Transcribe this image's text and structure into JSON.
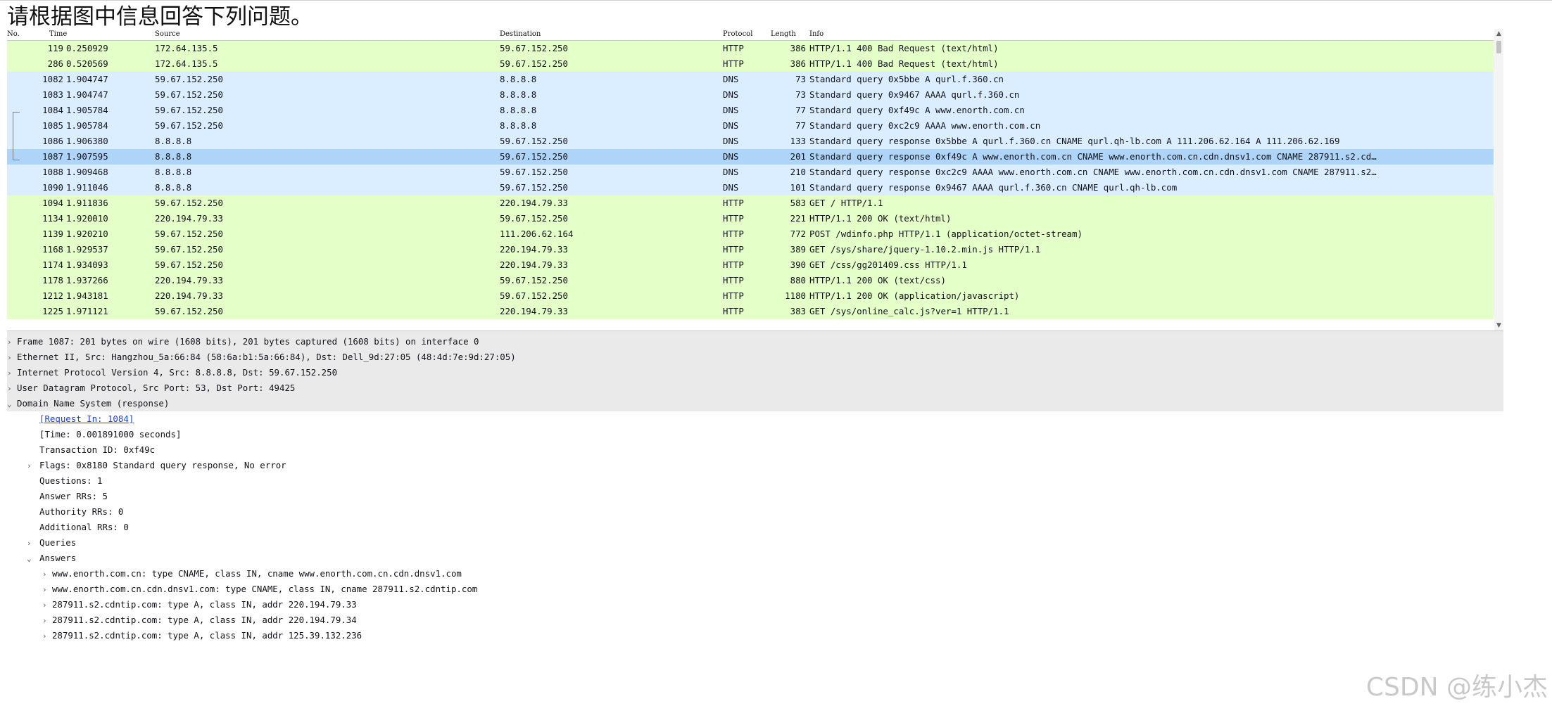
{
  "question": "请根据图中信息回答下列问题。",
  "columns": {
    "no": "No.",
    "time": "Time",
    "source": "Source",
    "destination": "Destination",
    "protocol": "Protocol",
    "length": "Length",
    "info": "Info"
  },
  "packets": [
    {
      "no": "119",
      "time": "0.250929",
      "src": "172.64.135.5",
      "dst": "59.67.152.250",
      "proto": "HTTP",
      "len": "386",
      "info": "HTTP/1.1 400 Bad Request  (text/html)"
    },
    {
      "no": "286",
      "time": "0.520569",
      "src": "172.64.135.5",
      "dst": "59.67.152.250",
      "proto": "HTTP",
      "len": "386",
      "info": "HTTP/1.1 400 Bad Request  (text/html)"
    },
    {
      "no": "1082",
      "time": "1.904747",
      "src": "59.67.152.250",
      "dst": "8.8.8.8",
      "proto": "DNS",
      "len": "73",
      "info": "Standard query 0x5bbe A qurl.f.360.cn"
    },
    {
      "no": "1083",
      "time": "1.904747",
      "src": "59.67.152.250",
      "dst": "8.8.8.8",
      "proto": "DNS",
      "len": "73",
      "info": "Standard query 0x9467 AAAA qurl.f.360.cn"
    },
    {
      "no": "1084",
      "time": "1.905784",
      "src": "59.67.152.250",
      "dst": "8.8.8.8",
      "proto": "DNS",
      "len": "77",
      "info": "Standard query 0xf49c A www.enorth.com.cn"
    },
    {
      "no": "1085",
      "time": "1.905784",
      "src": "59.67.152.250",
      "dst": "8.8.8.8",
      "proto": "DNS",
      "len": "77",
      "info": "Standard query 0xc2c9 AAAA www.enorth.com.cn"
    },
    {
      "no": "1086",
      "time": "1.906380",
      "src": "8.8.8.8",
      "dst": "59.67.152.250",
      "proto": "DNS",
      "len": "133",
      "info": "Standard query response 0x5bbe A qurl.f.360.cn CNAME qurl.qh-lb.com A 111.206.62.164 A 111.206.62.169"
    },
    {
      "no": "1087",
      "time": "1.907595",
      "src": "8.8.8.8",
      "dst": "59.67.152.250",
      "proto": "DNS",
      "len": "201",
      "info": "Standard query response 0xf49c A www.enorth.com.cn CNAME www.enorth.com.cn.cdn.dnsv1.com CNAME 287911.s2.cd…"
    },
    {
      "no": "1088",
      "time": "1.909468",
      "src": "8.8.8.8",
      "dst": "59.67.152.250",
      "proto": "DNS",
      "len": "210",
      "info": "Standard query response 0xc2c9 AAAA www.enorth.com.cn CNAME www.enorth.com.cn.cdn.dnsv1.com CNAME 287911.s2…"
    },
    {
      "no": "1090",
      "time": "1.911046",
      "src": "8.8.8.8",
      "dst": "59.67.152.250",
      "proto": "DNS",
      "len": "101",
      "info": "Standard query response 0x9467 AAAA qurl.f.360.cn CNAME qurl.qh-lb.com"
    },
    {
      "no": "1094",
      "time": "1.911836",
      "src": "59.67.152.250",
      "dst": "220.194.79.33",
      "proto": "HTTP",
      "len": "583",
      "info": "GET / HTTP/1.1"
    },
    {
      "no": "1134",
      "time": "1.920010",
      "src": "220.194.79.33",
      "dst": "59.67.152.250",
      "proto": "HTTP",
      "len": "221",
      "info": "HTTP/1.1 200 OK  (text/html)"
    },
    {
      "no": "1139",
      "time": "1.920210",
      "src": "59.67.152.250",
      "dst": "111.206.62.164",
      "proto": "HTTP",
      "len": "772",
      "info": "POST /wdinfo.php HTTP/1.1  (application/octet-stream)"
    },
    {
      "no": "1168",
      "time": "1.929537",
      "src": "59.67.152.250",
      "dst": "220.194.79.33",
      "proto": "HTTP",
      "len": "389",
      "info": "GET /sys/share/jquery-1.10.2.min.js HTTP/1.1"
    },
    {
      "no": "1174",
      "time": "1.934093",
      "src": "59.67.152.250",
      "dst": "220.194.79.33",
      "proto": "HTTP",
      "len": "390",
      "info": "GET /css/gg201409.css HTTP/1.1"
    },
    {
      "no": "1178",
      "time": "1.937266",
      "src": "220.194.79.33",
      "dst": "59.67.152.250",
      "proto": "HTTP",
      "len": "880",
      "info": "HTTP/1.1 200 OK  (text/css)"
    },
    {
      "no": "1212",
      "time": "1.943181",
      "src": "220.194.79.33",
      "dst": "59.67.152.250",
      "proto": "HTTP",
      "len": "1180",
      "info": "HTTP/1.1 200 OK  (application/javascript)"
    },
    {
      "no": "1225",
      "time": "1.971121",
      "src": "59.67.152.250",
      "dst": "220.194.79.33",
      "proto": "HTTP",
      "len": "383",
      "info": "GET /sys/online_calc.js?ver=1 HTTP/1.1"
    }
  ],
  "selected_packet_no": "1087",
  "details": {
    "frame": "Frame 1087: 201 bytes on wire (1608 bits), 201 bytes captured (1608 bits) on interface 0",
    "ethernet": "Ethernet II, Src: Hangzhou_5a:66:84 (58:6a:b1:5a:66:84), Dst: Dell_9d:27:05 (48:4d:7e:9d:27:05)",
    "ip": "Internet Protocol Version 4, Src: 8.8.8.8, Dst: 59.67.152.250",
    "udp": "User Datagram Protocol, Src Port: 53, Dst Port: 49425",
    "dns": "Domain Name System (response)",
    "request_in": "[Request In: 1084]",
    "time": "[Time: 0.001891000 seconds]",
    "transaction_id": "Transaction ID: 0xf49c",
    "flags": "Flags: 0x8180 Standard query response, No error",
    "questions": "Questions: 1",
    "answer_rrs": "Answer RRs: 5",
    "authority_rrs": "Authority RRs: 0",
    "additional_rrs": "Additional RRs: 0",
    "queries": "Queries",
    "answers": "Answers",
    "answer_items": [
      "www.enorth.com.cn: type CNAME, class IN, cname www.enorth.com.cn.cdn.dnsv1.com",
      "www.enorth.com.cn.cdn.dnsv1.com: type CNAME, class IN, cname 287911.s2.cdntip.com",
      "287911.s2.cdntip.com: type A, class IN, addr 220.194.79.33",
      "287911.s2.cdntip.com: type A, class IN, addr 220.194.79.34",
      "287911.s2.cdntip.com: type A, class IN, addr 125.39.132.236"
    ]
  },
  "watermark": "CSDN @练小杰"
}
